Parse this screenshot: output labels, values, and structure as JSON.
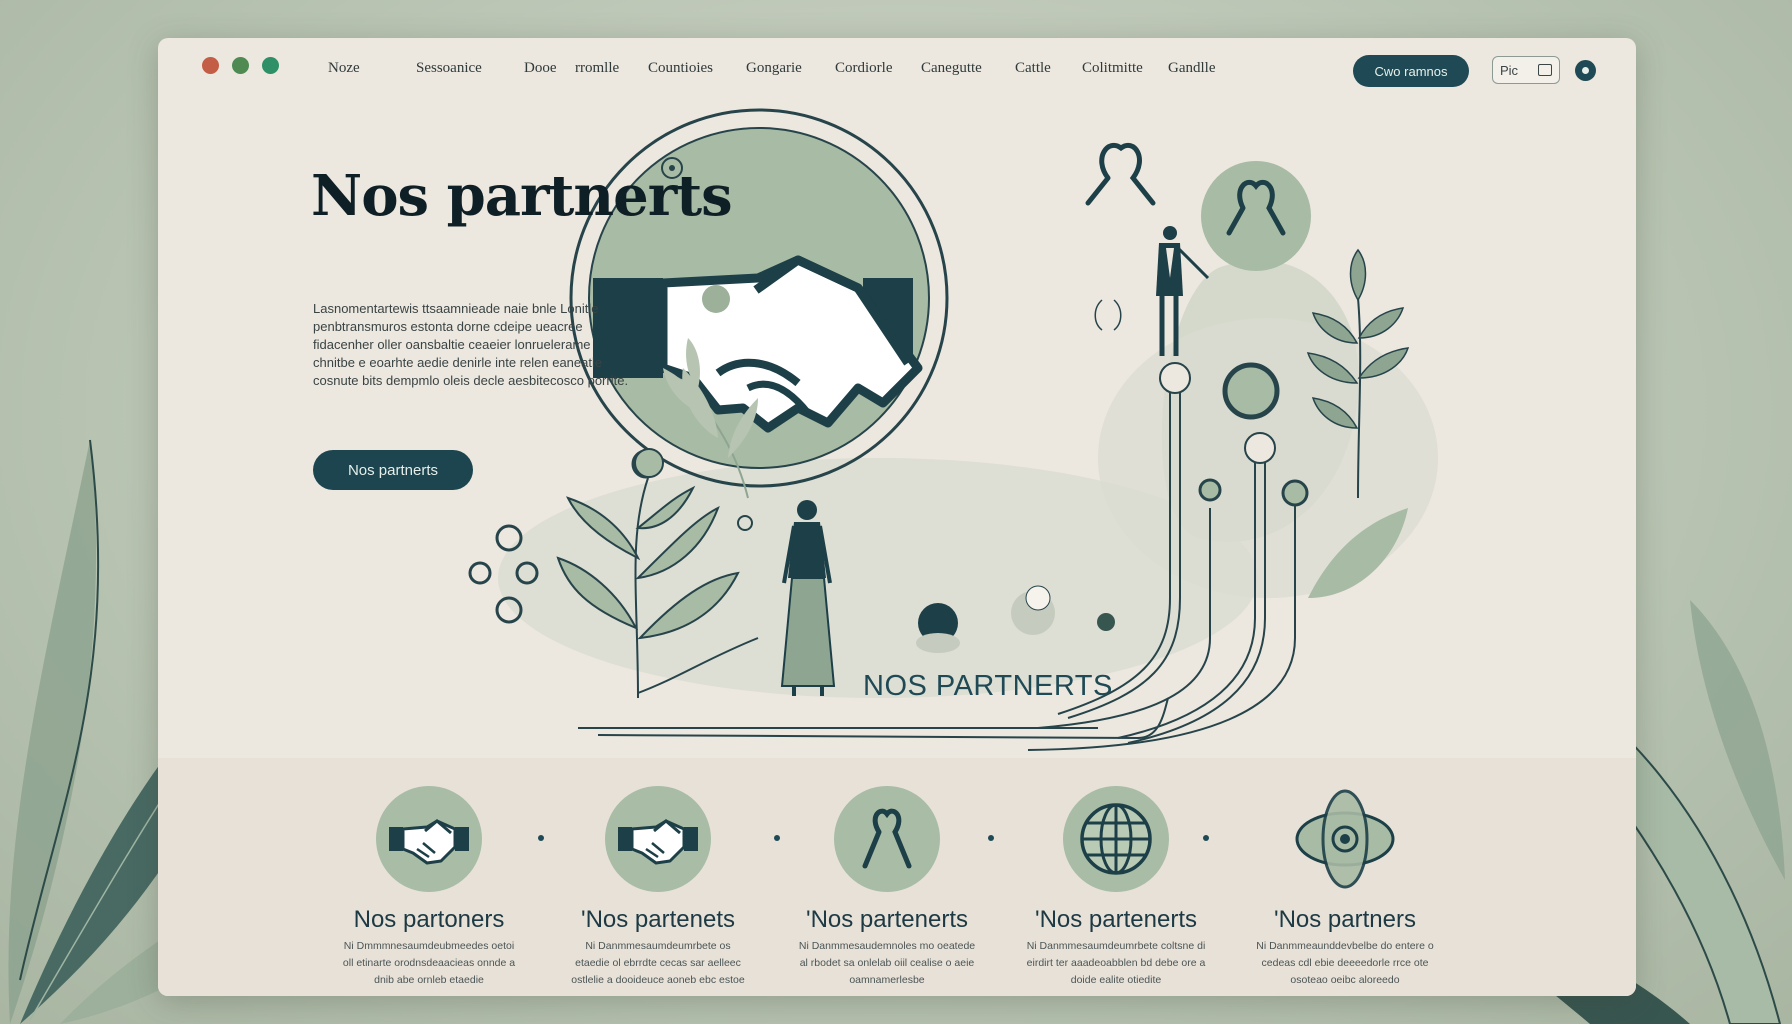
{
  "window": {
    "traffic_lights": [
      "#c35d45",
      "#4f8a52",
      "#2f8f66"
    ]
  },
  "nav": {
    "items": [
      "Noze",
      "Sessoanice",
      "Dooe",
      "rromlle",
      "Countioies",
      "Gongarie",
      "Cordiorle",
      "Canegutte",
      "Cattle",
      "Colitmitte",
      "Gandlle"
    ],
    "cta_label": "Cwo ramnos",
    "lang_label": "Pic",
    "colors": {
      "primary": "#1f4a55",
      "accent_green": "#a9bca5"
    }
  },
  "hero": {
    "title": "Nos partnerts",
    "paragraph": "Lasnomentartewis ttsaamnieade naie bnle Lonitle penbtransmuros estonta dorne cdeipe ueacree fidacenher oller oansbaltie ceaeier lonruelerame chnitbe e eoarhte aedie denirle inte relen eaneatle cosnute bits dempmlo oleis decle aesbitecosco porrite.",
    "button_label": "Nos partnerts",
    "illustration_caption": "NOS PARTNERTS"
  },
  "partners": [
    {
      "icon": "handshake-icon",
      "title": "Nos partoners",
      "desc": "Ni Dmmmnesaumdeubmeedes oetoi oll etinarte orodnsdeaacieas onnde a dnib abe ornleb etaedie"
    },
    {
      "icon": "handshake-icon",
      "title": "'Nos partenets",
      "desc": "Ni Danmmesaumdeumrbete os etaedie ol ebrrdte cecas sar aelleec ostlelie a dooideuce aoneb ebc estoe"
    },
    {
      "icon": "ribbon-icon",
      "title": "'Nos partenerts",
      "desc": "Ni Danmmesaudemnoles mo oeatede al rbodet sa onlelab oiil cealise o aeie oamnamerlesbe"
    },
    {
      "icon": "globe-icon",
      "title": "'Nos partenerts",
      "desc": "Ni Danmmesaumdeumrbete coltsne di eirdirt ter aaadeoabblen bd debe ore a doide ealite otiedite"
    },
    {
      "icon": "atom-icon",
      "title": "'Nos partners",
      "desc": "Ni Danmmeaunddevbelbe do entere o cedeas cdl ebie deeeedorle rrce ote osoteao oeibc aloreedo"
    }
  ]
}
